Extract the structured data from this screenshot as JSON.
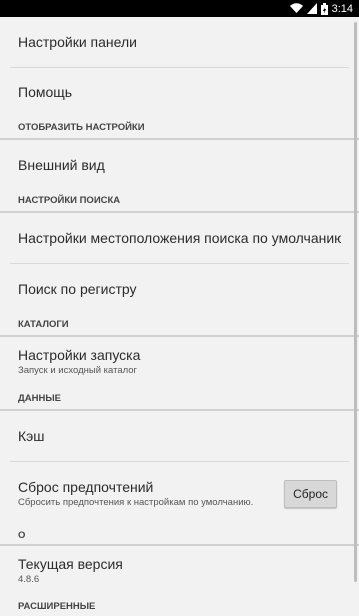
{
  "status_bar": {
    "time": "3:14",
    "icons": [
      "wifi-icon",
      "cell-signal-icon",
      "battery-icon"
    ]
  },
  "settings": {
    "panel_settings": "Настройки панели",
    "help": "Помощь",
    "display_category": "ОТОБРАЗИТЬ НАСТРОЙКИ",
    "appearance": "Внешний вид",
    "search_category": "НАСТРОЙКИ ПОИСКА",
    "default_search_location": "Настройки местоположения поиска по умолчанию",
    "case_search": "Поиск по регистру",
    "catalogs_category": "КАТАЛОГИ",
    "launch_settings": "Настройки запуска",
    "launch_settings_sub": "Запуск и исходный каталог",
    "data_category": "ДАННЫЕ",
    "cache": "Кэш",
    "reset_prefs": "Сброс предпочтений",
    "reset_prefs_sub": "Сбросить предпочтения к настройкам по умолчанию.",
    "reset_button": "Сброс",
    "about_category": "О",
    "current_version": "Текущая версия",
    "version_value": "4.8.6",
    "advanced_category": "РАСШИРЕННЫЕ"
  }
}
